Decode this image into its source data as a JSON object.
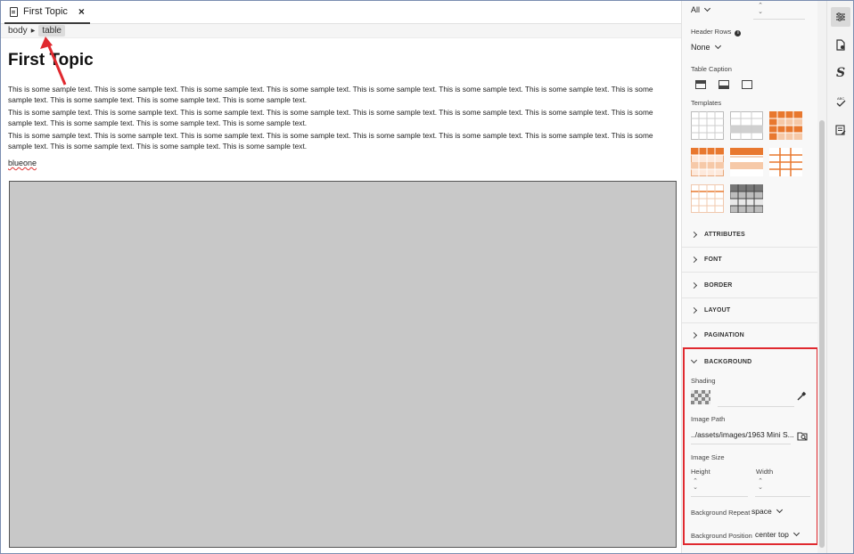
{
  "tab": {
    "title": "First Topic",
    "close_glyph": "×",
    "icon": "document-icon"
  },
  "breadcrumb": {
    "items": [
      "body",
      "table"
    ]
  },
  "document": {
    "heading": "First Topic",
    "paragraphs": [
      "This is some sample text. This is some sample text. This is some sample text. This is some sample text. This is some sample text. This is some sample text. This is some sample text. This is some sample text. This is some sample text. This is some sample text. This is some sample text.",
      "This is some sample text. This is some sample text. This is some sample text. This is some sample text. This is some sample text. This is some sample text. This is some sample text. This is some sample text. This is some sample text. This is some sample text. This is some sample text.",
      "This is some sample text. This is some sample text. This is some sample text. This is some sample text. This is some sample text. This is some sample text. This is some sample text. This is some sample text. This is some sample text. This is some sample text. This is some sample text."
    ],
    "link_text": "blueone"
  },
  "panel": {
    "top_select": "All",
    "header_rows": {
      "label": "Header Rows",
      "value": "None"
    },
    "table_caption": {
      "label": "Table Caption"
    },
    "templates": {
      "label": "Templates",
      "accent": "#e8782f",
      "accent_light": "#f6c9a8"
    },
    "sections": [
      "ATTRIBUTES",
      "FONT",
      "BORDER",
      "LAYOUT",
      "PAGINATION"
    ],
    "background": {
      "title": "BACKGROUND",
      "shading_label": "Shading",
      "image_path_label": "Image Path",
      "image_path_value": "../assets/images/1963 Mini S...",
      "image_size_label": "Image Size",
      "height_label": "Height",
      "width_label": "Width",
      "repeat_label": "Background Repeat",
      "repeat_value": "space",
      "position_label": "Background Position",
      "position_value": "center top",
      "highlight_color": "#e0292f"
    }
  },
  "rail": {
    "icons": [
      "properties-icon",
      "document-settings-icon",
      "styles-icon",
      "spellcheck-icon",
      "notes-icon"
    ]
  }
}
